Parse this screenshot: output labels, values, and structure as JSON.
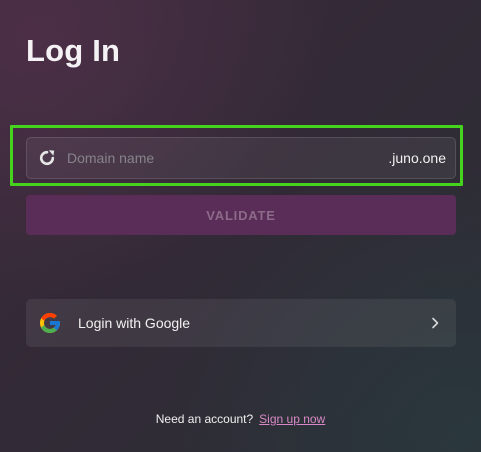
{
  "page": {
    "title": "Log In"
  },
  "domain": {
    "placeholder": "Domain name",
    "value": "",
    "suffix": ".juno.one",
    "icon": "refresh-icon"
  },
  "validate": {
    "label": "VALIDATE"
  },
  "google": {
    "label": "Login with Google",
    "icon": "google-icon",
    "chevron": "chevron-right-icon"
  },
  "footer": {
    "prompt": "Need an account?",
    "signup_label": "Sign up now"
  },
  "colors": {
    "focus_ring": "#45d31d",
    "validate_bg": "#5a2d58",
    "validate_text": "#8c6a89",
    "link": "#d889c6"
  }
}
